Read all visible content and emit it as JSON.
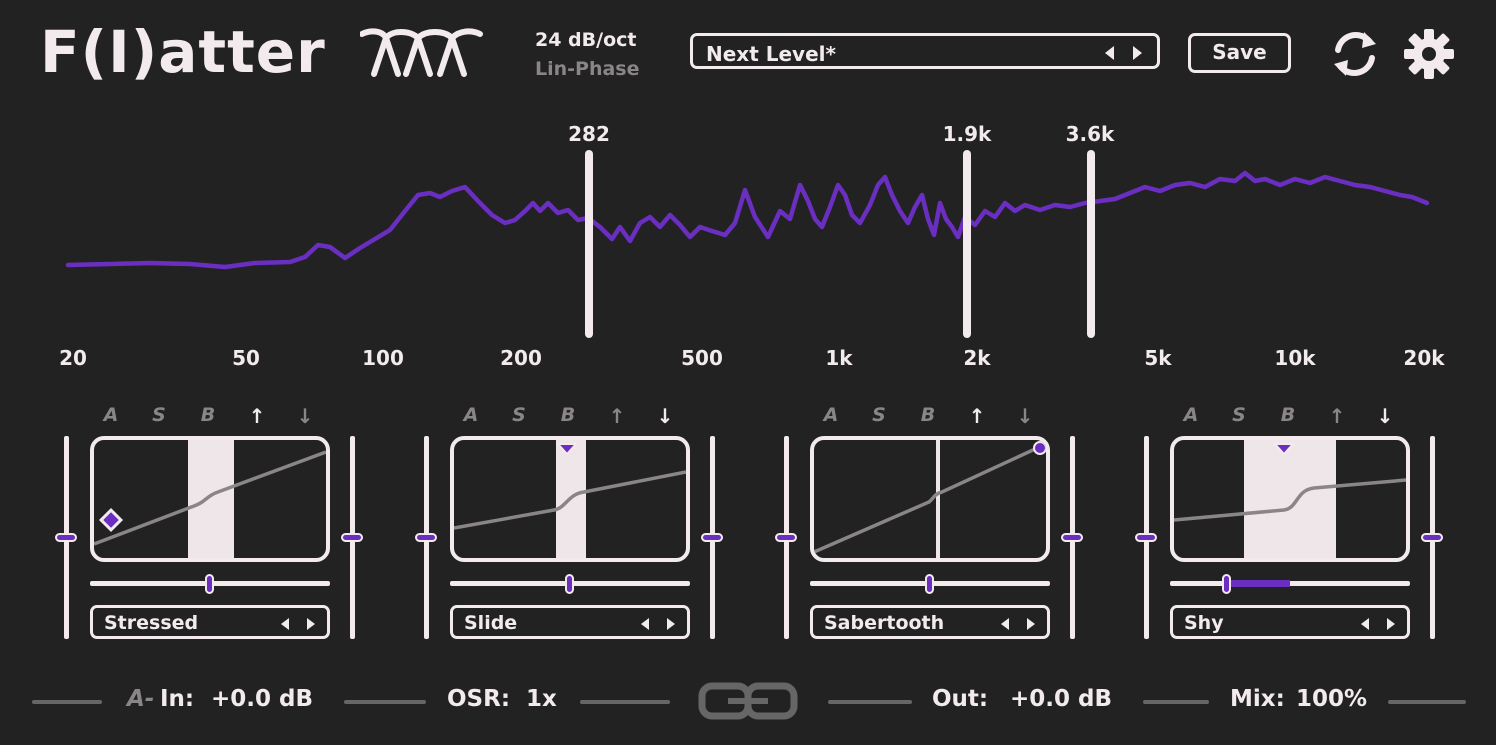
{
  "app": {
    "logo": "F(I)atter"
  },
  "header": {
    "slope": "24 dB/oct",
    "phase": "Lin-Phase",
    "preset_name": "Next Level*",
    "save_label": "Save",
    "icons": [
      "filter-slope-icon",
      "reload-icon",
      "gear-icon"
    ]
  },
  "spectrum": {
    "crossovers": [
      "282",
      "1.9k",
      "3.6k"
    ],
    "axis_labels": [
      "20",
      "50",
      "100",
      "200",
      "500",
      "1k",
      "2k",
      "5k",
      "10k",
      "20k"
    ],
    "line_color": "#6a2fc0"
  },
  "bands": [
    {
      "modes": [
        "A",
        "S",
        "B"
      ],
      "up": "↑",
      "down": "↓",
      "preset": "Stressed",
      "active_arrow": "up"
    },
    {
      "modes": [
        "A",
        "S",
        "B"
      ],
      "up": "↑",
      "down": "↓",
      "preset": "Slide",
      "active_arrow": "down"
    },
    {
      "modes": [
        "A",
        "S",
        "B"
      ],
      "up": "↑",
      "down": "↓",
      "preset": "Sabertooth",
      "active_arrow": "up"
    },
    {
      "modes": [
        "A",
        "S",
        "B"
      ],
      "up": "↑",
      "down": "↓",
      "preset": "Shy",
      "active_arrow": "down"
    }
  ],
  "footer": {
    "input_prefix": "A-",
    "input_label": "In:",
    "input_value": "+0.0 dB",
    "osr_label": "OSR:",
    "osr_value": "1x",
    "out_label": "Out:",
    "out_value": "+0.0 dB",
    "mix_label": "Mix:",
    "mix_value": "100%"
  },
  "colors": {
    "background": "#222222",
    "foreground": "#f2eaec",
    "accent": "#6a2fc0",
    "muted": "#8a8586"
  }
}
